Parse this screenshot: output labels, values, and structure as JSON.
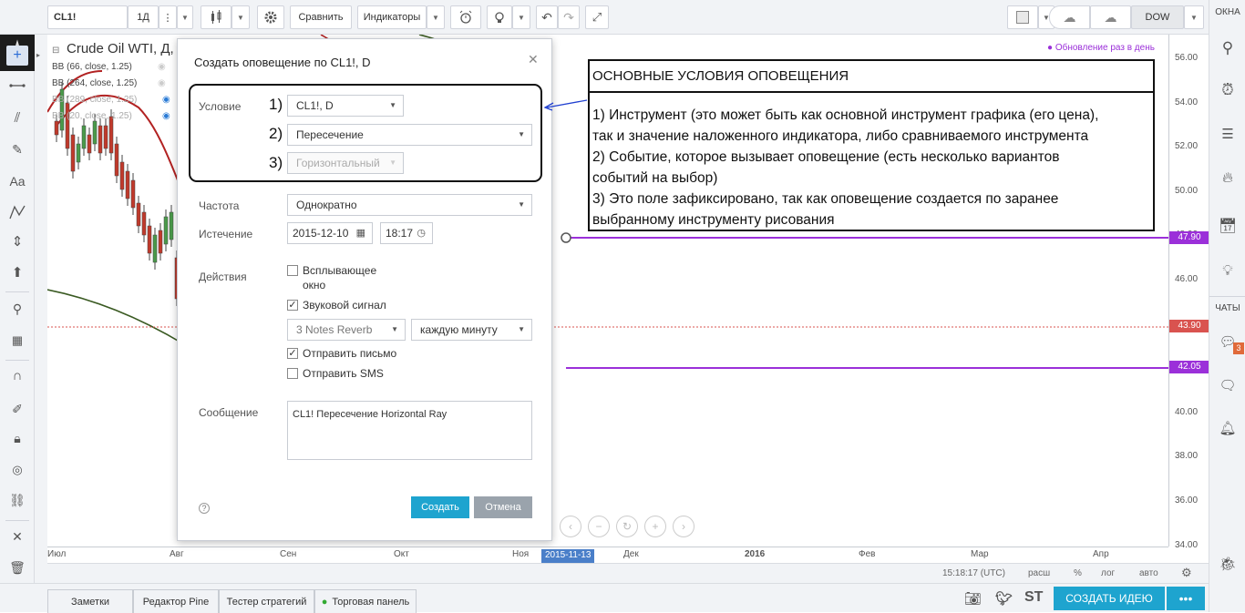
{
  "toolbar": {
    "symbol": "CL1!",
    "interval": "1Д",
    "compare": "Сравнить",
    "indicators": "Индикаторы",
    "layout_name": "DOW"
  },
  "right_sidebar": {
    "windows_label": "ОКНА",
    "chats_label": "ЧАТЫ",
    "chat_badge": "3"
  },
  "chart": {
    "title": "Crude Oil WTI, Д,",
    "update_note": "Обновление раз в день",
    "legend": [
      "BB (66, close, 1.25)",
      "BB (264, close, 1.25)",
      "BB (289, close, 1.25)",
      "BB (20, close, 1.25)"
    ],
    "price_ticks": [
      "56.00",
      "54.00",
      "52.00",
      "50.00",
      "48.00",
      "46.00",
      "44.00",
      "42.00",
      "40.00",
      "38.00",
      "36.00",
      "34.00"
    ],
    "price_tags": [
      {
        "value": "47.90",
        "color": "#9b30d9"
      },
      {
        "value": "43.90",
        "color": "#d9534f"
      },
      {
        "value": "42.05",
        "color": "#9b30d9"
      }
    ],
    "time_ticks": [
      "Июл",
      "Авг",
      "Сен",
      "Окт",
      "Ноя",
      "Дек",
      "2016",
      "Фев",
      "Мар",
      "Апр"
    ],
    "cursor_date": "2015-11-13"
  },
  "statusbar": {
    "time": "15:18:17 (UTC)",
    "scale": "расш",
    "percent": "%",
    "log": "лог",
    "auto": "авто"
  },
  "bottom_tabs": [
    "Заметки",
    "Редактор Pine",
    "Тестер стратегий",
    "Торговая панель"
  ],
  "create_idea": "СОЗДАТЬ ИДЕЮ",
  "dialog": {
    "title": "Создать оповещение по CL1!, D",
    "condition_label": "Условие",
    "cond1": "CL1!, D",
    "cond2": "Пересечение",
    "cond3": "Горизонтальный",
    "n1": "1)",
    "n2": "2)",
    "n3": "3)",
    "frequency_label": "Частота",
    "frequency": "Однократно",
    "expiry_label": "Истечение",
    "expiry_date": "2015-12-10",
    "expiry_time": "18:17",
    "actions_label": "Действия",
    "popup_label_1": "Всплывающее",
    "popup_label_2": "окно",
    "sound_label": "Звуковой сигнал",
    "sound_name": "3 Notes Reverb",
    "sound_repeat": "каждую минуту",
    "email_label": "Отправить письмо",
    "sms_label": "Отправить SMS",
    "message_label": "Сообщение",
    "message": "CL1! Пересечение Horizontal Ray",
    "create_button": "Создать",
    "cancel_button": "Отмена"
  },
  "annotation": {
    "header": "ОСНОВНЫЕ УСЛОВИЯ ОПОВЕЩЕНИЯ",
    "line1": "1) Инструмент (это может быть как основной инструмент графика (его цена),",
    "line2": "так и значение наложенного индикатора, либо сравниваемого инструмента",
    "line3": "2) Событие, которое вызывает оповещение (есть несколько вариантов",
    "line4": "событий на выбор)",
    "line5": "3) Это поле зафиксировано, так как оповещение создается по заранее",
    "line6": "выбранному инструменту рисования"
  },
  "colors": {
    "accent": "#1ea4cf",
    "ray": "#9b30d9",
    "down_candle": "#c0392b",
    "up_candle": "#4a9a4a"
  }
}
